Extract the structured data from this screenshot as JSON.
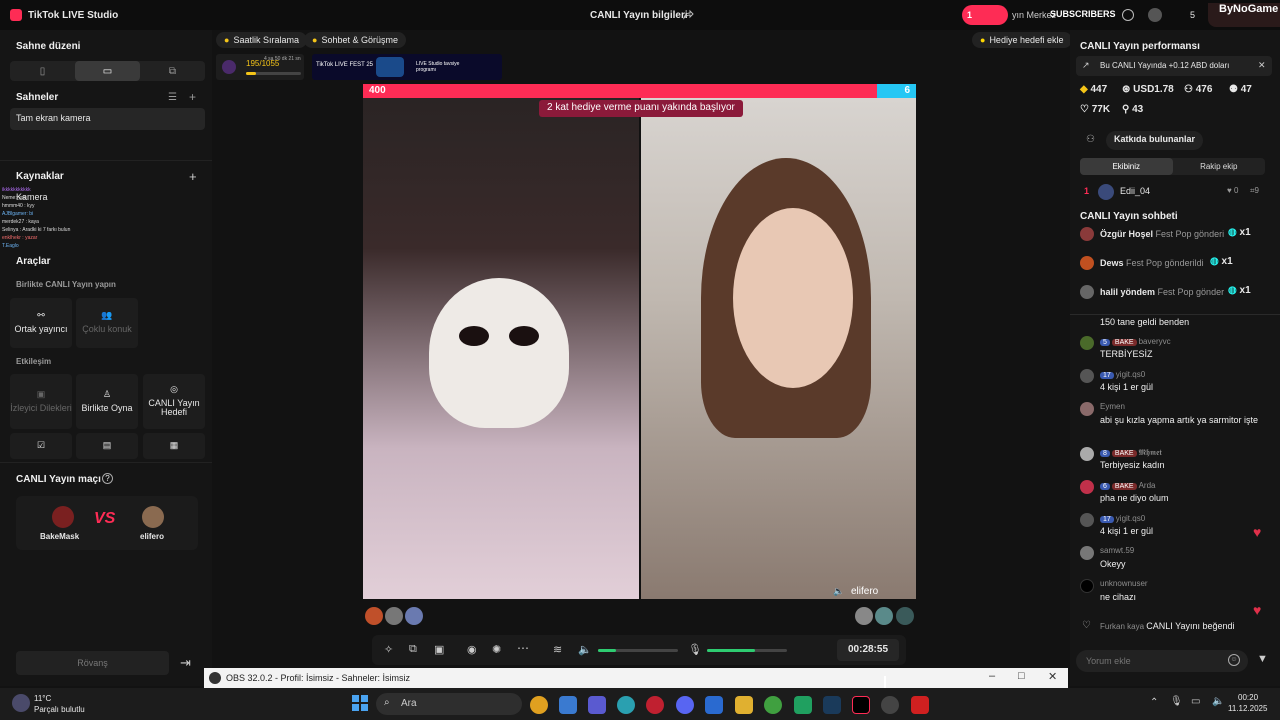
{
  "app": {
    "title": "TikTok LIVE Studio",
    "live_info": "CANLI Yayın bilgileri",
    "center_label": "yın Merkez",
    "subscribers": "SUBSCRIBERS",
    "sub_count": "1",
    "profile_count": "5",
    "channel": "ByNoGame"
  },
  "left": {
    "scene_layout_title": "Sahne düzeni",
    "scenes_title": "Sahneler",
    "scene_item": "Tam ekran kamera",
    "sources_title": "Kaynaklar",
    "source_item": "Kamera",
    "tools_title": "Araçlar",
    "together_title": "Birlikte CANLI Yayın yapın",
    "cohost": "Ortak yayıncı",
    "multi_guest": "Çoklu konuk",
    "interaction_title": "Etkileşim",
    "viewer_requests": "İzleyici Dilekleri",
    "play_together": "Birlikte Oyna",
    "live_goal": "CANLI Yayın Hedefi",
    "match_title": "CANLI Yayın maçı",
    "player1": "BakeMask",
    "player2": "elifero",
    "vs": "VS",
    "rematch": "Rövanş"
  },
  "overlay_chat": [
    "ikkkkkkkkkkk",
    "Neme: yok",
    "hmmm40 : kyy",
    "AJBlgamer: bi",
    "merdek27 : kaya",
    "Selinya : Aradki ki 7 farkı bulun",
    "enklhekr : yazar",
    "T.Eaglo"
  ],
  "center": {
    "tab1": "Saatlik Sıralama",
    "tab2": "Sohbet & Görüşme",
    "gift_goal": "Hediye hedefi ekle",
    "progress_text": "195/1055",
    "progress_sub": "4 sa 50 dk 21 sn",
    "progress_fraction": 0.18,
    "banner1": "TikTok LIVE FEST 25",
    "banner2": "LIVE Studio tavsiye programı",
    "score_left": "400",
    "score_right": "6",
    "left_share": 0.93,
    "battle_notice": "2 kat hediye verme puanı yakında başlıyor",
    "guest_name": "elifero",
    "timer": "00:28:55",
    "volume_level": 0.22,
    "mic_level": 0.6
  },
  "right": {
    "perf_title": "CANLI Yayın performansı",
    "earnings": "Bu CANLI Yayında +0.12 ABD doları",
    "stats": {
      "diamonds": "447",
      "usd": "USD1.78",
      "viewers": "476",
      "likes_top": "47",
      "hearts": "77K",
      "shares": "43"
    },
    "contributors": "Katkıda bulunanlar",
    "tab_team": "Ekibiniz",
    "tab_rival": "Rakip ekip",
    "rank_num": "1",
    "rank_user": "Edii_04",
    "rank_likes": "0",
    "rank_gifts": "9",
    "chat_title": "CANLI Yayın sohbeti",
    "gifts": [
      {
        "user": "Özgür Hoşel",
        "text": "Fest Pop gönderi",
        "count": "x1"
      },
      {
        "user": "Dews",
        "text": "Fest Pop gönderildi",
        "count": "x1"
      },
      {
        "user": "halil yöndem",
        "text": "Fest Pop gönder",
        "count": "x1"
      }
    ],
    "messages": [
      {
        "name": "",
        "text": "150 tane geldi benden"
      },
      {
        "name": "baveryvc",
        "level": "5",
        "club": "BAKE",
        "text": "TERBİYESİZ"
      },
      {
        "name": "yigit.qs0",
        "level": "17",
        "text": "4 kişi 1 er gül"
      },
      {
        "name": "Eymen",
        "text": "abi şu kızla yapma artık ya sarmitor işte"
      },
      {
        "name": "𝕸𝖍𝖒𝖊𝖙",
        "level": "8",
        "club": "BAKE",
        "text": "Terbiyesiz kadın"
      },
      {
        "name": "Arda",
        "level": "6",
        "club": "BAKE",
        "text": "pha ne diyo olum"
      },
      {
        "name": "yigit.qs0",
        "level": "17",
        "text": "4 kişi 1 er gül"
      },
      {
        "name": "samwt.59",
        "text": "Okeyy"
      },
      {
        "name": "unknownuser",
        "text": "ne cihazı"
      }
    ],
    "liked_user": "Furkan kaya",
    "liked_text": "CANLI Yayını beğendi",
    "comment_placeholder": "Yorum ekle"
  },
  "obs": {
    "title": "OBS 32.0.2 - Profil: İsimsiz - Sahneler: İsimsiz"
  },
  "taskbar": {
    "temp": "11°C",
    "weather": "Parçalı bulutlu",
    "search": "Ara",
    "time": "00:20",
    "date": "11.12.2025"
  },
  "colors": {
    "accent_pink": "#fe2c55",
    "accent_cyan": "#25f4ee",
    "green": "#2ecc71"
  }
}
